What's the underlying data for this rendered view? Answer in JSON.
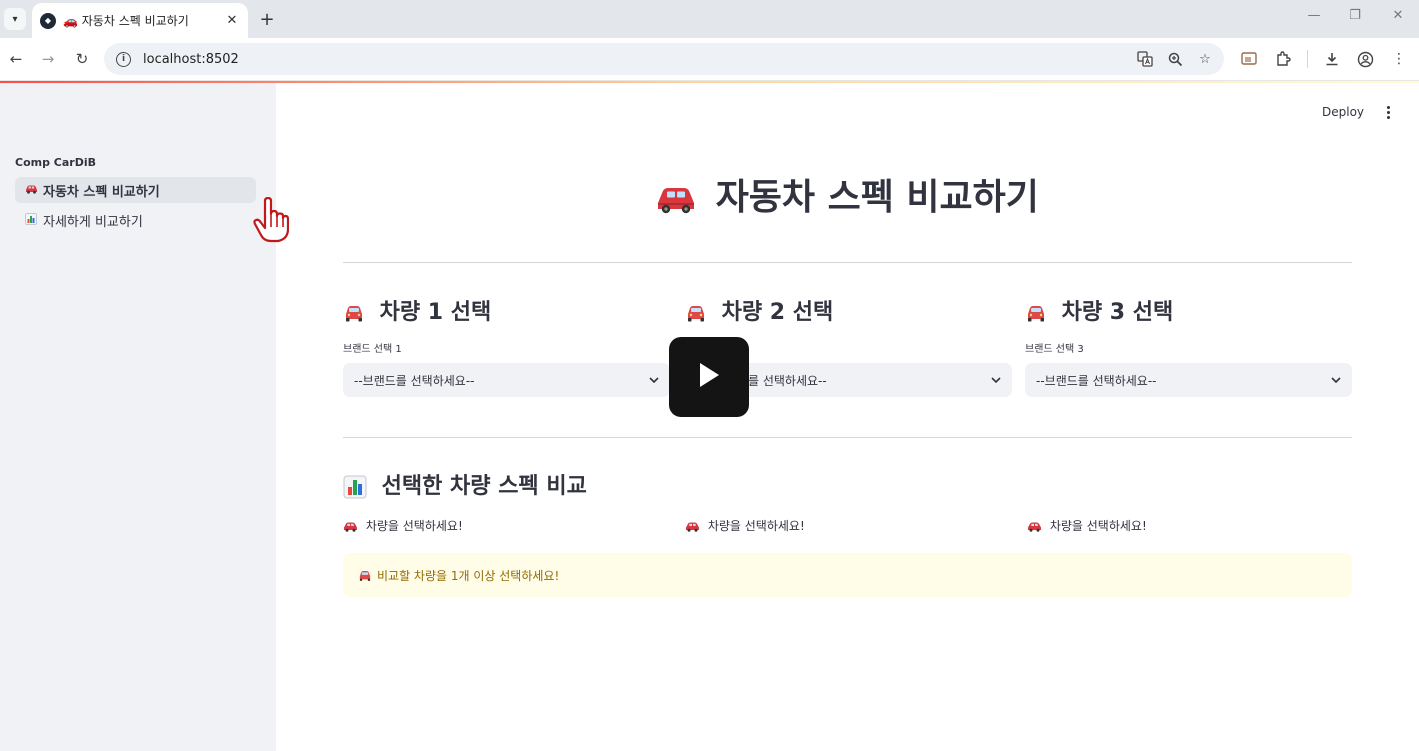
{
  "browser": {
    "tab_title": "🚗 자동차 스펙 비교하기",
    "url": "localhost:8502"
  },
  "sidebar": {
    "group_label": "Comp CarDiB",
    "items": [
      {
        "emoji": "🚗",
        "label": "자동차 스펙 비교하기",
        "active": true
      },
      {
        "emoji": "📊",
        "label": "자세하게 비교하기",
        "active": false
      }
    ]
  },
  "header": {
    "deploy_label": "Deploy"
  },
  "main": {
    "title": "자동차 스펙 비교하기",
    "columns": [
      {
        "title": "차량 1 선택",
        "brand_label": "브랜드 선택 1",
        "brand_value": "--브랜드를 선택하세요--"
      },
      {
        "title": "차량 2 선택",
        "brand_label": "",
        "brand_value": "를 선택하세요--"
      },
      {
        "title": "차량 3 선택",
        "brand_label": "브랜드 선택 3",
        "brand_value": "--브랜드를 선택하세요--"
      }
    ],
    "compare_title": "선택한 차량 스펙 비교",
    "prompts": [
      "차량을 선택하세요!",
      "차량을 선택하세요!",
      "차량을 선택하세요!"
    ],
    "warning": "비교할 차량을 1개 이상 선택하세요!"
  },
  "colors": {
    "accent": "#ff4b4b",
    "sidebar_bg": "#f0f2f6",
    "warning_bg": "#fffce7",
    "warning_text": "#926c05"
  }
}
